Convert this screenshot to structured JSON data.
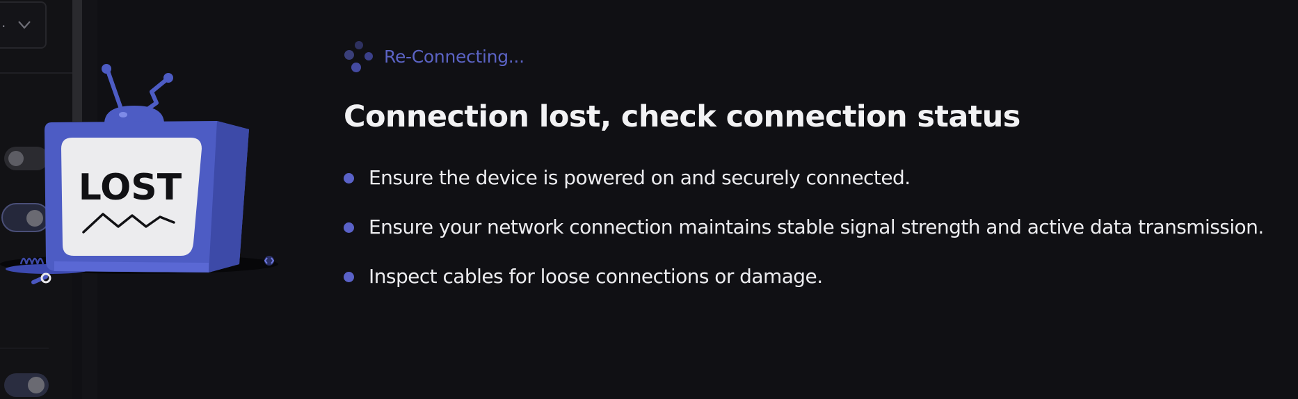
{
  "background_panel": {
    "dropdown_value": ".",
    "dropdown_icon": "chevron-down-icon",
    "toggles": [
      {
        "state": "off"
      },
      {
        "state": "on"
      },
      {
        "state": "on"
      }
    ]
  },
  "illustration": {
    "screen_text": "LOST",
    "icon": "tv-lost-icon"
  },
  "status": {
    "icon": "spinner-icon",
    "text": "Re-Connecting...",
    "color": "#5b63c4"
  },
  "headline": "Connection lost, check connection status",
  "tips": [
    {
      "text": "Ensure the device is powered on and securely connected."
    },
    {
      "text": "Ensure your network connection maintains stable signal strength and active data transmission."
    },
    {
      "text": "Inspect cables for loose connections or damage."
    }
  ],
  "colors": {
    "background": "#101014",
    "accent": "#5a62c8",
    "tv_body": "#4d5cc4",
    "text_primary": "#f2f2f4"
  }
}
